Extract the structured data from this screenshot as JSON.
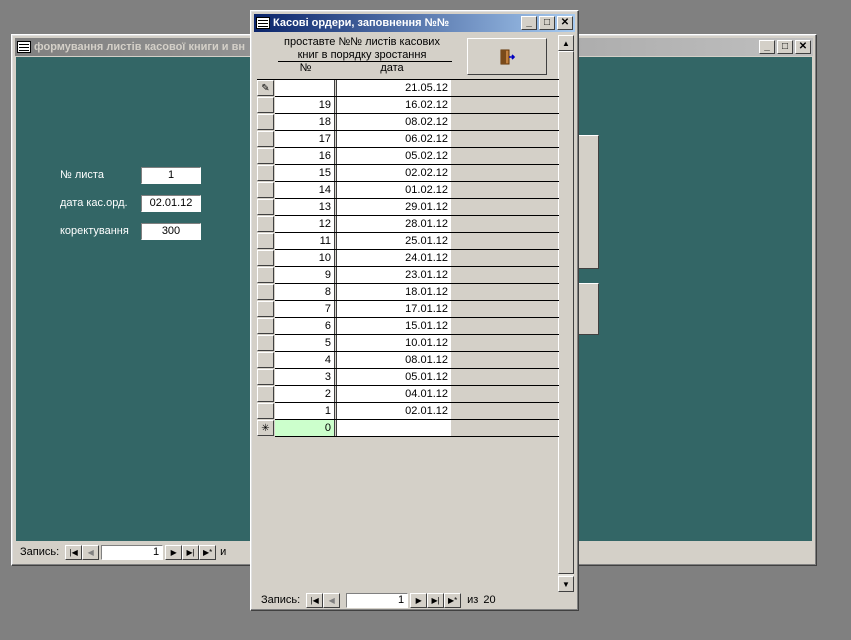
{
  "back_window": {
    "title": "формування листів касової книги и вн",
    "fields": [
      {
        "label": "№ листа",
        "value": "1"
      },
      {
        "label": "дата кас.орд.",
        "value": "02.01.12"
      },
      {
        "label": "коректування",
        "value": "300"
      }
    ],
    "nav": {
      "label": "Запись:",
      "current": "1",
      "suffix": "и"
    }
  },
  "front_window": {
    "title": "Касові ордери, заповнення №№",
    "header_line1": "проставте №№ листів касових",
    "header_line2": "книг в порядку зростання",
    "col_num": "№",
    "col_date": "дата",
    "exit_button": "exit-door-icon",
    "editing_row": {
      "num": "",
      "date": "21.05.12"
    },
    "rows": [
      {
        "num": "19",
        "date": "16.02.12"
      },
      {
        "num": "18",
        "date": "08.02.12"
      },
      {
        "num": "17",
        "date": "06.02.12"
      },
      {
        "num": "16",
        "date": "05.02.12"
      },
      {
        "num": "15",
        "date": "02.02.12"
      },
      {
        "num": "14",
        "date": "01.02.12"
      },
      {
        "num": "13",
        "date": "29.01.12"
      },
      {
        "num": "12",
        "date": "28.01.12"
      },
      {
        "num": "11",
        "date": "25.01.12"
      },
      {
        "num": "10",
        "date": "24.01.12"
      },
      {
        "num": "9",
        "date": "23.01.12"
      },
      {
        "num": "8",
        "date": "18.01.12"
      },
      {
        "num": "7",
        "date": "17.01.12"
      },
      {
        "num": "6",
        "date": "15.01.12"
      },
      {
        "num": "5",
        "date": "10.01.12"
      },
      {
        "num": "4",
        "date": "08.01.12"
      },
      {
        "num": "3",
        "date": "05.01.12"
      },
      {
        "num": "2",
        "date": "04.01.12"
      },
      {
        "num": "1",
        "date": "02.01.12"
      }
    ],
    "new_row": {
      "num": "0",
      "date": ""
    },
    "nav": {
      "label": "Запись:",
      "current": "1",
      "of_label": "из",
      "total": "20"
    }
  },
  "colors": {
    "form_bg": "#336666",
    "title_active": "#0a246a",
    "new_row_highlight": "#ccffcc"
  }
}
